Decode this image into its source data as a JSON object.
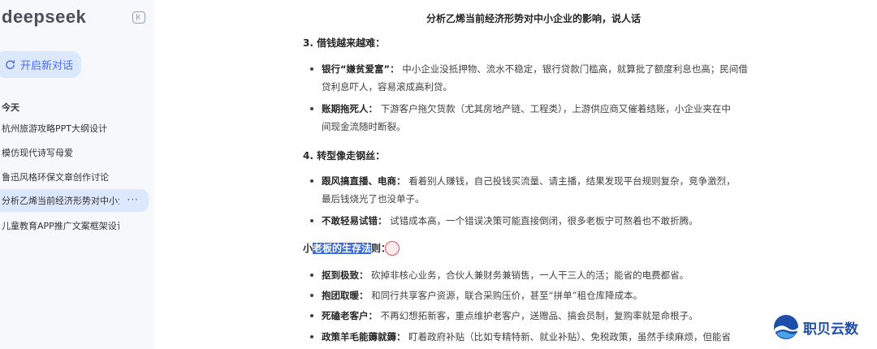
{
  "sidebar": {
    "logo": "deepseek",
    "new_chat_label": "开启新对话",
    "section_today": "今天",
    "items": [
      {
        "label": "杭州旅游攻略PPT大纲设计"
      },
      {
        "label": "模仿现代诗写母爱"
      },
      {
        "label": "鲁迅风格环保文章创作讨论"
      },
      {
        "label": "分析乙烯当前经济形势对中小企业的影响，说人话",
        "active": true,
        "menu": "···"
      },
      {
        "label": "儿童教育APP推广文案框架设计"
      }
    ]
  },
  "main": {
    "title": "分析乙烯当前经济形势对中小企业的影响，说人话",
    "sections": [
      {
        "heading": "3. 借钱越来越难：",
        "bullets": [
          {
            "term": "银行“嫌贫爱富”：",
            "desc": "中小企业没抵押物、流水不稳定，银行贷款门槛高，就算批了额度利息也高；民间借",
            "desc2": "贷利息吓人，容易滚成高利贷。"
          },
          {
            "term": "账期拖死人：",
            "desc": "下游客户拖欠货款（尤其房地产链、工程类），上游供应商又催着结账，小企业夹在中",
            "desc2": "间现金流随时断裂。"
          }
        ]
      },
      {
        "heading": "4. 转型像走钢丝：",
        "bullets": [
          {
            "term": "跟风搞直播、电商：",
            "desc": "看着别人赚钱，自己投钱买流量、请主播，结果发现平台规则复杂，竞争激烈，",
            "desc2": "最后钱烧光了也没单子。"
          },
          {
            "term": "不敢轻易试错：",
            "desc": "试错成本高，一个错误决策可能直接倒闭，很多老板宁可熬着也不敢折腾。"
          }
        ]
      },
      {
        "heading_prefix": "小",
        "heading_highlight": "老板的生存法",
        "heading_suffix": "则：",
        "bullets": [
          {
            "term": "抠到极致：",
            "desc": "砍掉非核心业务，合伙人兼财务兼销售，一人干三人的活；能省的电费都省。"
          },
          {
            "term": "抱团取暖：",
            "desc": "和同行共享客户资源，联合采购压价，甚至“拼单”租仓库降成本。"
          },
          {
            "term": "死磕老客户：",
            "desc": "不再幻想拓新客，重点维护老客户，送赠品、搞会员制，复购率就是命根子。"
          },
          {
            "term": "政策羊毛能薅就薅：",
            "desc": "盯着政府补贴（比如专精特新、就业补贴）、免税政策，虽然手续麻烦，但能省"
          }
        ]
      }
    ]
  },
  "watermark": {
    "text": "职贝云数"
  },
  "colors": {
    "accent": "#4d6bfe",
    "sidebar_bg": "#f7f8fc",
    "active_bg": "#dbe8fd",
    "highlight": "#3b6bd6"
  }
}
